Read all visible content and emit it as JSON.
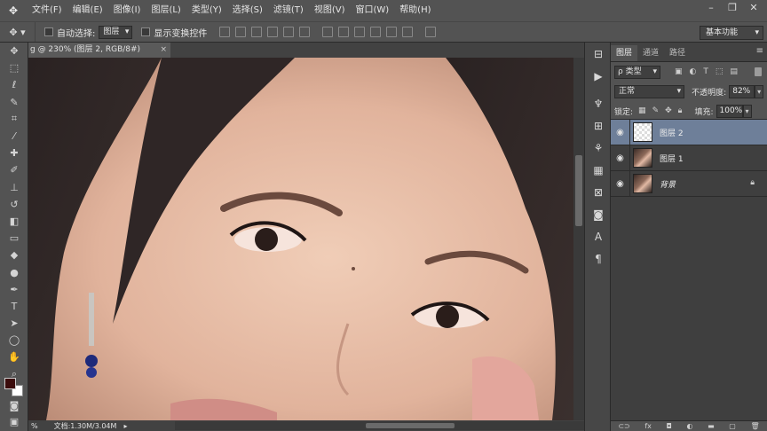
{
  "menubar": {
    "items": [
      "文件(F)",
      "编辑(E)",
      "图像(I)",
      "图层(L)",
      "类型(Y)",
      "选择(S)",
      "滤镜(T)",
      "视图(V)",
      "窗口(W)",
      "帮助(H)"
    ]
  },
  "options_bar": {
    "auto_select_label": "自动选择:",
    "auto_select_value": "图层",
    "show_transform_label": "显示变换控件",
    "workspace": "基本功能"
  },
  "document": {
    "tab_title": "g @ 230% (图层 2, RGB/8#)",
    "status_zoom": "%",
    "status_doc": "文档:1.30M/3.04M"
  },
  "layers_panel": {
    "tabs": [
      "图层",
      "通道",
      "路径"
    ],
    "active_tab": "图层",
    "kind_filter": "ρ 类型",
    "blend_mode": "正常",
    "opacity_label": "不透明度:",
    "opacity_value": "82%",
    "lock_label": "锁定:",
    "fill_label": "填充:",
    "fill_value": "100%",
    "layers": [
      {
        "name": "图层 2",
        "selected": true
      },
      {
        "name": "图层 1",
        "selected": false
      },
      {
        "name": "背景",
        "selected": false,
        "locked": true
      }
    ]
  },
  "colors": {
    "foreground": "#3b0c0c",
    "background": "#ffffff",
    "selected_layer": "#6e7f99"
  }
}
